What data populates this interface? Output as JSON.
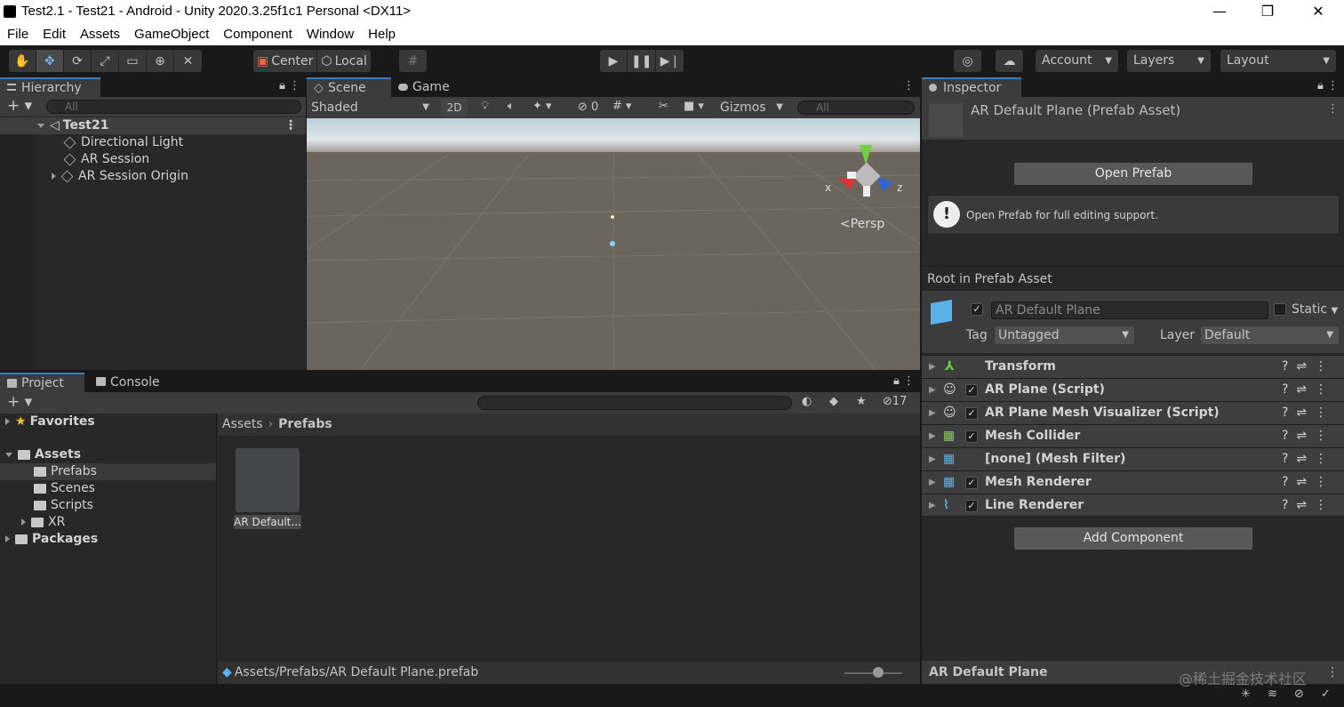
{
  "window": {
    "title": "Test2.1 - Test21 - Android - Unity 2020.3.25f1c1 Personal <DX11>",
    "minimize": "—",
    "maximize": "❐",
    "close": "✕"
  },
  "menu": [
    "File",
    "Edit",
    "Assets",
    "GameObject",
    "Component",
    "Window",
    "Help"
  ],
  "toolbar": {
    "pivot": "Center",
    "space": "Local",
    "account": "Account",
    "layers": "Layers",
    "layout": "Layout"
  },
  "hierarchy": {
    "tab": "Hierarchy",
    "search_placeholder": "All",
    "scene": "Test21",
    "items": [
      "Directional Light",
      "AR Session",
      "AR Session Origin"
    ]
  },
  "scene_view": {
    "tab_scene": "Scene",
    "tab_game": "Game",
    "shading": "Shaded",
    "mode_2d": "2D",
    "hidden_count": "0",
    "gizmos": "Gizmos",
    "search_placeholder": "All",
    "axis_x": "x",
    "axis_z": "z",
    "persp": "Persp"
  },
  "project": {
    "tab_project": "Project",
    "tab_console": "Console",
    "hidden_count": "17",
    "tree": {
      "favorites": "Favorites",
      "assets": "Assets",
      "children": [
        "Prefabs",
        "Scenes",
        "Scripts",
        "XR"
      ],
      "packages": "Packages"
    },
    "breadcrumb_root": "Assets",
    "breadcrumb_current": "Prefabs",
    "asset_name": "AR Default...",
    "status_path": "Assets/Prefabs/AR Default Plane.prefab"
  },
  "inspector": {
    "tab": "Inspector",
    "header_title": "AR Default Plane (Prefab Asset)",
    "open_prefab": "Open Prefab",
    "help_text": "Open Prefab for full editing support.",
    "root_label": "Root in Prefab Asset",
    "object_name": "AR Default Plane",
    "static_label": "Static",
    "tag_label": "Tag",
    "tag_value": "Untagged",
    "layer_label": "Layer",
    "layer_value": "Default",
    "components": [
      "Transform",
      "AR Plane (Script)",
      "AR Plane Mesh Visualizer (Script)",
      "Mesh Collider",
      "[none] (Mesh Filter)",
      "Mesh Renderer",
      "Line Renderer"
    ],
    "add_component": "Add Component",
    "footer_name": "AR Default Plane"
  },
  "watermark": "@稀土掘金技术社区",
  "colors": {
    "accent": "#3a79bb",
    "panel": "#282828",
    "toolbar": "#191919"
  }
}
